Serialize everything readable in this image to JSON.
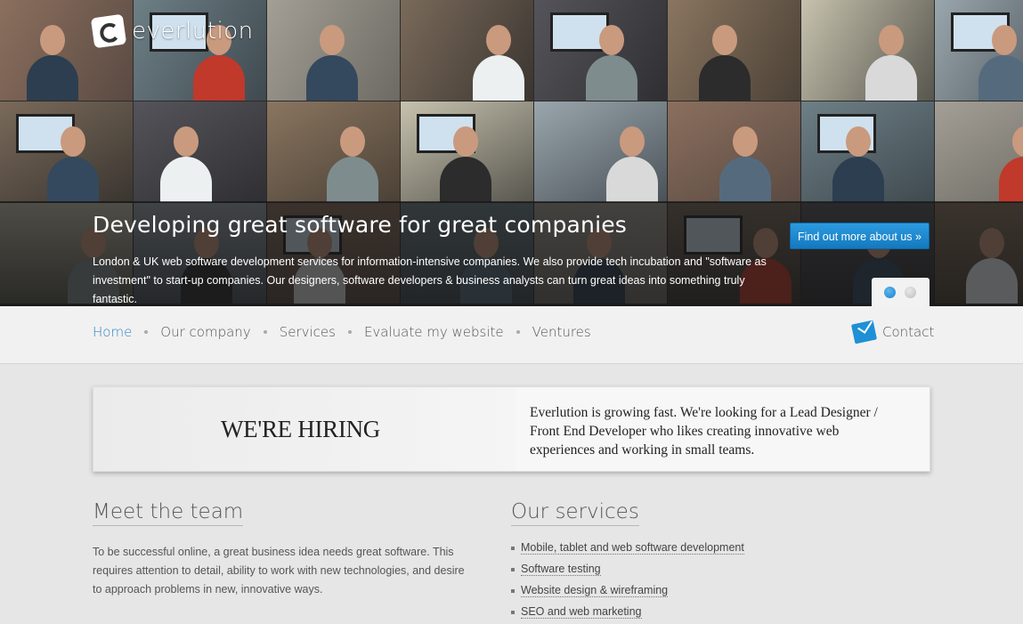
{
  "brand": {
    "name": "everlution"
  },
  "hero": {
    "title": "Developing great software for great companies",
    "description": "London & UK web software development services for information-intensive companies. We also provide tech incubation and \"software as investment\" to start-up companies. Our designers, software developers & business analysts can turn great ideas into something truly fantastic.",
    "cta_label": "Find out more about us »",
    "slides": 2,
    "active_slide": 1,
    "accent": "#1f8fd6"
  },
  "nav": {
    "items": [
      {
        "label": "Home",
        "active": true
      },
      {
        "label": "Our company",
        "active": false
      },
      {
        "label": "Services",
        "active": false
      },
      {
        "label": "Evaluate my website",
        "active": false
      },
      {
        "label": "Ventures",
        "active": false
      }
    ],
    "contact_label": "Contact",
    "contact_icon": "mail-icon"
  },
  "hiring": {
    "title": "WE'RE HIRING",
    "text": "Everlution is growing fast. We're looking for a Lead Designer / Front End Developer who likes creating innovative web experiences and working in small teams."
  },
  "team": {
    "title": "Meet the team",
    "text": "To be successful online, a great business idea needs great software. This requires attention to detail, ability to work with new technologies, and desire to approach problems in new, innovative ways."
  },
  "services": {
    "title": "Our services",
    "items": [
      "Mobile, tablet and web software development",
      "Software testing",
      "Website design & wireframing",
      "SEO and web marketing"
    ]
  }
}
